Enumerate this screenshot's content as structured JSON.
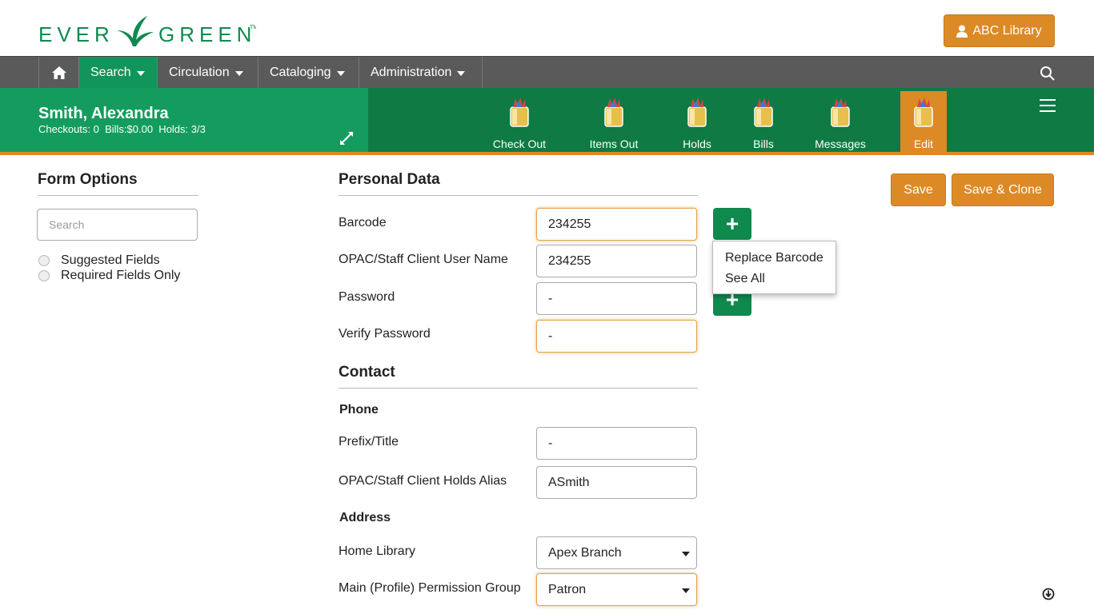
{
  "header": {
    "logo_text": "EVERGREEN",
    "library_button": "ABC Library"
  },
  "nav": {
    "search": "Search",
    "circulation": "Circulation",
    "cataloging": "Cataloging",
    "administration": "Administration"
  },
  "patron": {
    "name": "Smith, Alexandra",
    "stats": "Checkouts: 0  Bills:$0.00  Holds: 3/3",
    "tabs": [
      {
        "label": "Check Out"
      },
      {
        "label": "Items Out"
      },
      {
        "label": "Holds"
      },
      {
        "label": "Bills"
      },
      {
        "label": "Messages"
      },
      {
        "label": "Edit"
      }
    ]
  },
  "sidebar": {
    "title": "Form Options",
    "search_placeholder": "Search",
    "options": [
      "Suggested Fields",
      "Required Fields Only"
    ]
  },
  "form": {
    "personal_title": "Personal Data",
    "barcode_label": "Barcode",
    "barcode_value": "234255",
    "username_label": "OPAC/Staff Client User Name",
    "username_value": "234255",
    "password_label": "Password",
    "password_value": "-",
    "verify_label": "Verify Password",
    "verify_value": "-",
    "contact_title": "Contact",
    "phone_title": "Phone",
    "prefix_label": "Prefix/Title",
    "prefix_value": "-",
    "alias_label": "OPAC/Staff Client Holds Alias",
    "alias_value": "ASmith",
    "address_title": "Address",
    "home_lib_label": "Home Library",
    "home_lib_value": "Apex Branch",
    "perm_label": "Main (Profile) Permission Group",
    "perm_value": "Patron"
  },
  "barcode_menu": [
    "Replace Barcode",
    "See All"
  ],
  "actions": {
    "save": "Save",
    "save_clone": "Save & Clone"
  }
}
